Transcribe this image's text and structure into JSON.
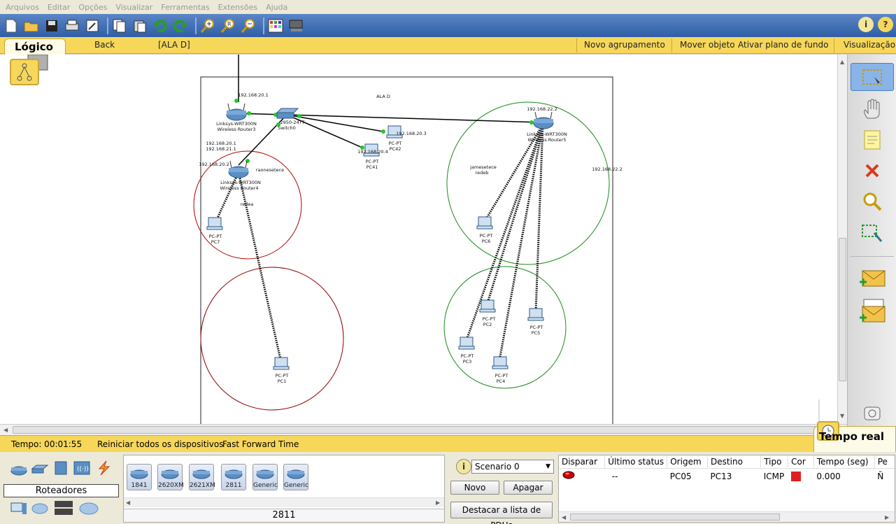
{
  "menu": [
    "Arquivos",
    "Editar",
    "Opções",
    "Visualizar",
    "Ferramentas",
    "Extensões",
    "Ajuda"
  ],
  "toolbar": {
    "left_icons": [
      "new-file-icon",
      "open-folder-icon",
      "save-icon",
      "print-icon",
      "activity-wizard-icon",
      "copy-icon",
      "paste-icon",
      "undo-icon",
      "redo-icon",
      "zoom-in-icon",
      "zoom-reset-icon",
      "zoom-out-icon",
      "palette-icon",
      "custom-device-icon"
    ],
    "right_icons": [
      "info-icon",
      "help-icon"
    ],
    "info_glyph": "i",
    "help_glyph": "?"
  },
  "logical_bar": {
    "tab_label": "Lógico",
    "back": "Back",
    "path": "[ALA D]",
    "new_cluster": "Novo agrupamento",
    "move_object": "Mover objeto",
    "set_background": "Ativar plano de fundo",
    "viewport": "Visualização"
  },
  "workspace": {
    "title_note": "ALA D",
    "devices": [
      {
        "id": "router3",
        "name": "Linksys-WRT300N",
        "sub": "Wireless Router3",
        "ip": "192.168.20.1"
      },
      {
        "id": "switch0",
        "name": "2950-24TT",
        "sub": "Switch0"
      },
      {
        "id": "pc42",
        "name": "PC-PT",
        "sub": "PC42",
        "ip": "192.168.20.3"
      },
      {
        "id": "pc41",
        "name": "PC-PT",
        "sub": "PC41",
        "ip": "192.168.20.4"
      },
      {
        "id": "router5",
        "name": "Linksys-WRT300N",
        "sub": "Wireless Router5",
        "ip": "192.168.22.2"
      },
      {
        "id": "router4",
        "name": "Linksys-WRT300N",
        "sub": "Wireless Router4",
        "ip": "192.168.20.2"
      },
      {
        "id": "pc7",
        "name": "PC-PT",
        "sub": "PC7"
      },
      {
        "id": "pc1",
        "name": "PC-PT",
        "sub": "PC1"
      },
      {
        "id": "pc6",
        "name": "PC-PT",
        "sub": "PC6"
      },
      {
        "id": "pc2",
        "name": "PC-PT",
        "sub": "PC2"
      },
      {
        "id": "pc5",
        "name": "PC-PT",
        "sub": "PC5"
      },
      {
        "id": "pc3",
        "name": "PC-PT",
        "sub": "PC3"
      },
      {
        "id": "pc4",
        "name": "PC-PT",
        "sub": "PC4"
      }
    ],
    "notes": {
      "router4_ips_1": "192.168.20.1",
      "router4_ips_2": "192.168.21.1",
      "router4_net": "raonesetece",
      "router4_net2": "redea",
      "router5_net": "jamesetece",
      "router5_net2": "redeb",
      "router5_ip_side": "192.168.22.2"
    }
  },
  "right_palette": [
    "select-icon",
    "hand-icon",
    "note-icon",
    "delete-icon",
    "inspect-icon",
    "resize-shape-icon",
    "add-simple-pdu-icon",
    "add-complex-pdu-icon"
  ],
  "time_bar": {
    "time": "Tempo: 00:01:55",
    "reset": "Reiniciar todos os dispositivos",
    "fast_forward": "Fast Forward Time",
    "mode": "Tempo real"
  },
  "device_panel": {
    "category_label": "Roteadores",
    "category_icons": [
      "routers-icon",
      "switches-icon",
      "hubs-icon",
      "wireless-icon",
      "connections-icon",
      "end-devices-icon",
      "wan-emulation-icon",
      "custom-devices-icon",
      "multiuser-icon"
    ],
    "models": [
      "1841",
      "2620XM",
      "2621XM",
      "2811",
      "Generic",
      "Generic"
    ],
    "selected_model": "2811"
  },
  "scenario": {
    "info_glyph": "i",
    "selected": "Scenario 0",
    "new_button": "Novo",
    "delete_button": "Apagar",
    "toggle_pdu_button": "Destacar a lista de PDUs"
  },
  "pdu_table": {
    "headers": [
      "Disparar",
      "Último status",
      "Origem",
      "Destino",
      "Tipo",
      "Cor",
      "Tempo (seg)",
      "Pe"
    ],
    "rows": [
      {
        "fire": "",
        "status": "--",
        "source": "PC05",
        "destination": "PC13",
        "type": "ICMP",
        "color": "#e02020",
        "time": "0.000",
        "periodic": "Ñ"
      }
    ]
  }
}
